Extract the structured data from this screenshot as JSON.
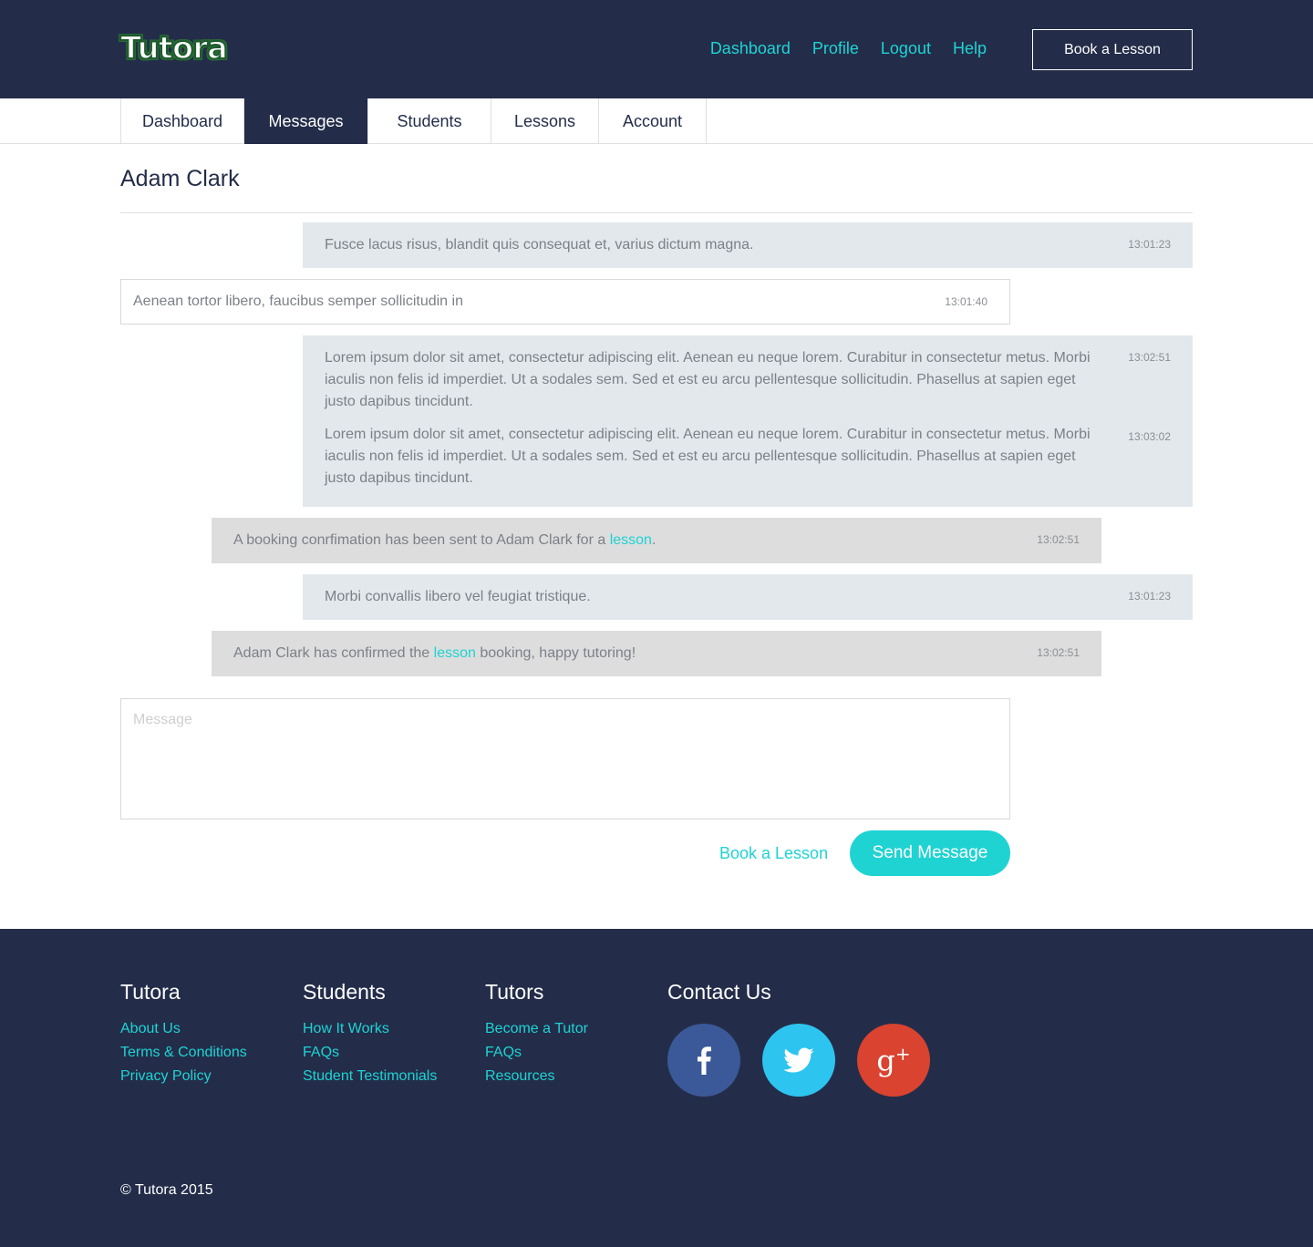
{
  "header": {
    "logo": "Tutora",
    "nav": [
      "Dashboard",
      "Profile",
      "Logout",
      "Help"
    ],
    "book_button": "Book a Lesson"
  },
  "tabs": [
    {
      "label": "Dashboard",
      "active": false
    },
    {
      "label": "Messages",
      "active": true
    },
    {
      "label": "Students",
      "active": false
    },
    {
      "label": "Lessons",
      "active": false
    },
    {
      "label": "Account",
      "active": false
    }
  ],
  "conversation": {
    "title": "Adam Clark",
    "messages": [
      {
        "type": "incoming",
        "text": "Fusce lacus risus, blandit quis consequat et, varius dictum magna.",
        "time": "13:01:23"
      },
      {
        "type": "outgoing",
        "text": "Aenean tortor libero, faucibus semper sollicitudin in",
        "time": "13:01:40"
      },
      {
        "type": "incoming",
        "text": "Lorem ipsum dolor sit amet, consectetur adipiscing elit. Aenean eu neque lorem. Curabitur in consectetur metus. Morbi iaculis non felis id imperdiet. Ut a sodales sem. Sed et est eu arcu pellentesque sollicitudin. Phasellus at sapien eget justo dapibus tincidunt.",
        "time": "13:02:51"
      },
      {
        "type": "incoming",
        "text": "Lorem ipsum dolor sit amet, consectetur adipiscing elit. Aenean eu neque lorem. Curabitur in consectetur metus. Morbi iaculis non felis id imperdiet. Ut a sodales sem. Sed et est eu arcu pellentesque sollicitudin. Phasellus at sapien eget justo dapibus tincidunt.",
        "time": "13:03:02"
      },
      {
        "type": "system",
        "text_before": "A booking conrfimation has been sent to Adam Clark for a ",
        "link": "lesson",
        "text_after": ".",
        "time": "13:02:51"
      },
      {
        "type": "incoming",
        "text": "Morbi convallis libero vel feugiat tristique.",
        "time": "13:01:23"
      },
      {
        "type": "system",
        "text_before": "Adam Clark has confirmed the ",
        "link": "lesson",
        "text_after": " booking, happy tutoring!",
        "time": "13:02:51"
      }
    ]
  },
  "compose": {
    "placeholder": "Message",
    "book_link": "Book a Lesson",
    "send_button": "Send Message"
  },
  "footer": {
    "columns": [
      {
        "title": "Tutora",
        "links": [
          "About Us",
          "Terms & Conditions",
          "Privacy Policy"
        ]
      },
      {
        "title": "Students",
        "links": [
          "How It Works",
          "FAQs",
          "Student Testimonials"
        ]
      },
      {
        "title": "Tutors",
        "links": [
          "Become a Tutor",
          "FAQs",
          "Resources"
        ]
      }
    ],
    "contact_title": "Contact Us",
    "social": [
      {
        "name": "facebook-icon",
        "color": "#3b5998"
      },
      {
        "name": "twitter-icon",
        "color": "#2ec4f0"
      },
      {
        "name": "google-plus-icon",
        "color": "#d9432f"
      }
    ],
    "copyright": "© Tutora 2015"
  },
  "colors": {
    "navy": "#232d4a",
    "accent": "#1fd3d3"
  }
}
